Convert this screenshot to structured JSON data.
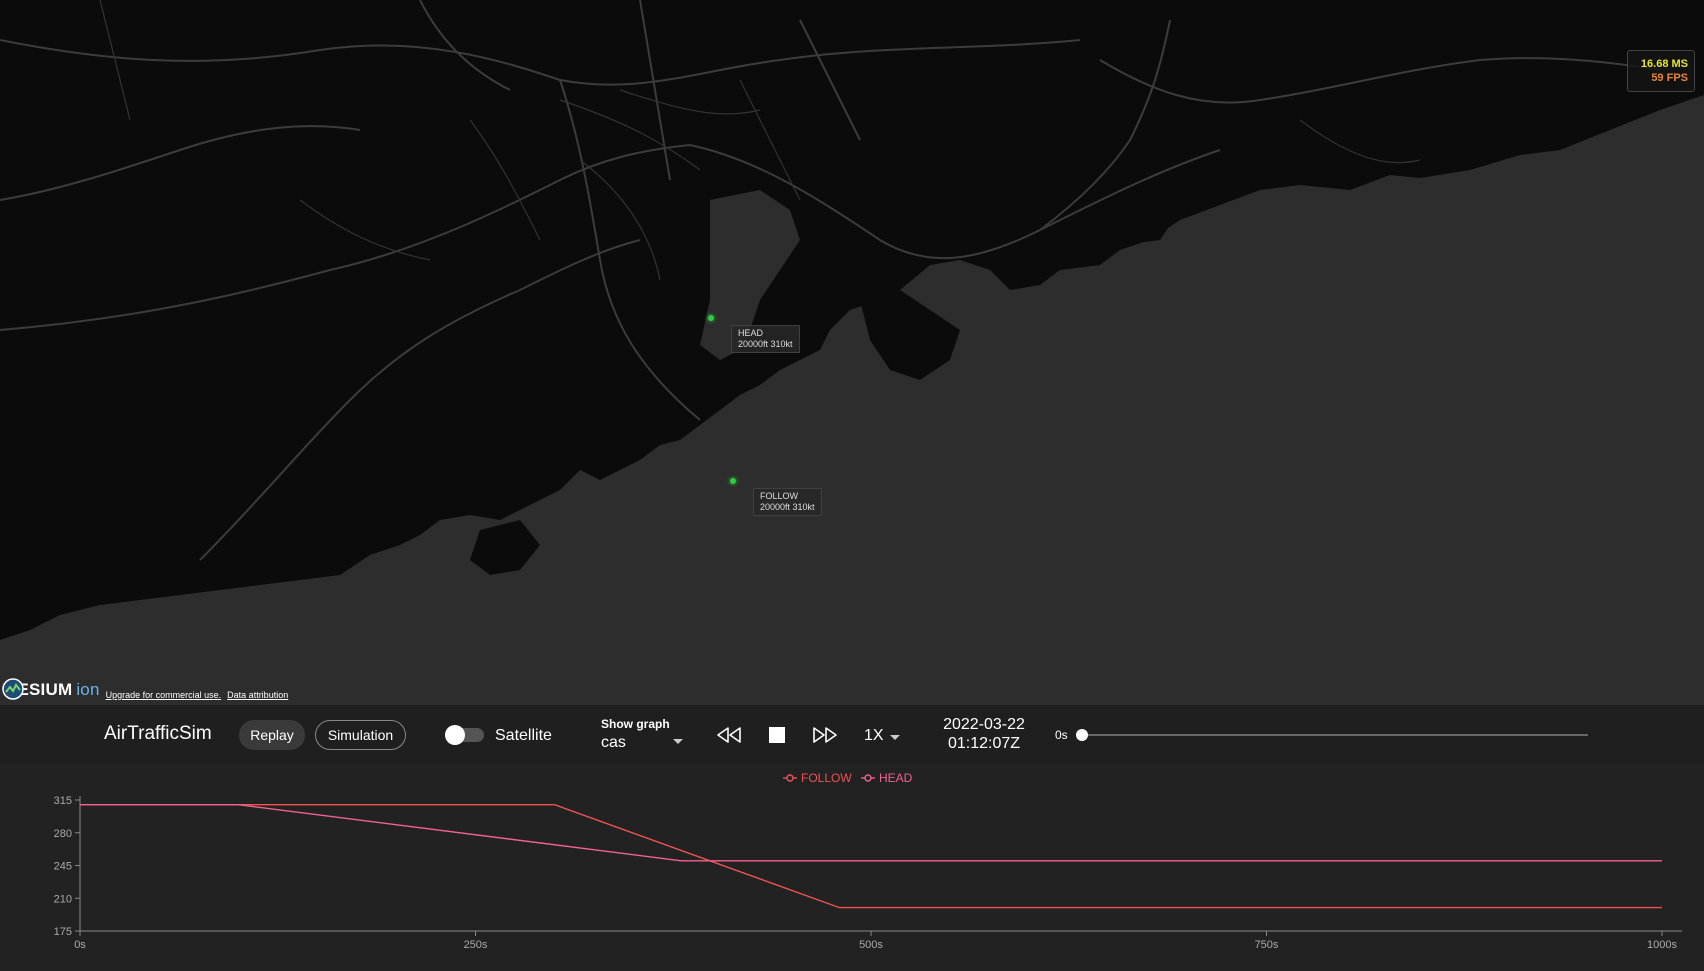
{
  "map": {
    "aircraft": [
      {
        "callsign": "HEAD",
        "info": "20000ft 310kt"
      },
      {
        "callsign": "FOLLOW",
        "info": "20000ft 310kt"
      }
    ],
    "performance": {
      "ms": "16.68 MS",
      "fps": "59 FPS"
    },
    "credits": {
      "logo_main": "CESIUM",
      "logo_ion": "ion",
      "upgrade": "Upgrade for commercial use.",
      "attribution": "Data attribution"
    }
  },
  "toolbar": {
    "app_title": "AirTrafficSim",
    "replay_label": "Replay",
    "simulation_label": "Simulation",
    "satellite_label": "Satellite",
    "show_graph_label": "Show graph",
    "graph_value": "cas",
    "speed": "1X",
    "date": "2022-03-22",
    "time": "01:12:07Z",
    "slider_label": "0s"
  },
  "colors": {
    "follow": "#ef5350",
    "head": "#f06292",
    "aircraft": "#2ecc40"
  },
  "icons": [
    "rewind-icon",
    "stop-icon",
    "fast-forward-icon",
    "dropdown-caret-icon",
    "cesium-logo-icon"
  ],
  "chart_data": {
    "type": "line",
    "x": [
      0,
      100,
      300,
      480,
      1000
    ],
    "series": [
      {
        "name": "FOLLOW",
        "points": [
          [
            0,
            310
          ],
          [
            300,
            310
          ],
          [
            480,
            200
          ],
          [
            1000,
            200
          ]
        ]
      },
      {
        "name": "HEAD",
        "points": [
          [
            0,
            310
          ],
          [
            100,
            310
          ],
          [
            380,
            250
          ],
          [
            1000,
            250
          ]
        ]
      }
    ],
    "xlim": [
      0,
      1000
    ],
    "ylim": [
      175,
      315
    ],
    "xticks": [
      "0s",
      "250s",
      "500s",
      "750s",
      "1000s"
    ],
    "yticks": [
      "315",
      "280",
      "245",
      "210",
      "175"
    ],
    "legend_position": "top-center",
    "grid": false
  }
}
